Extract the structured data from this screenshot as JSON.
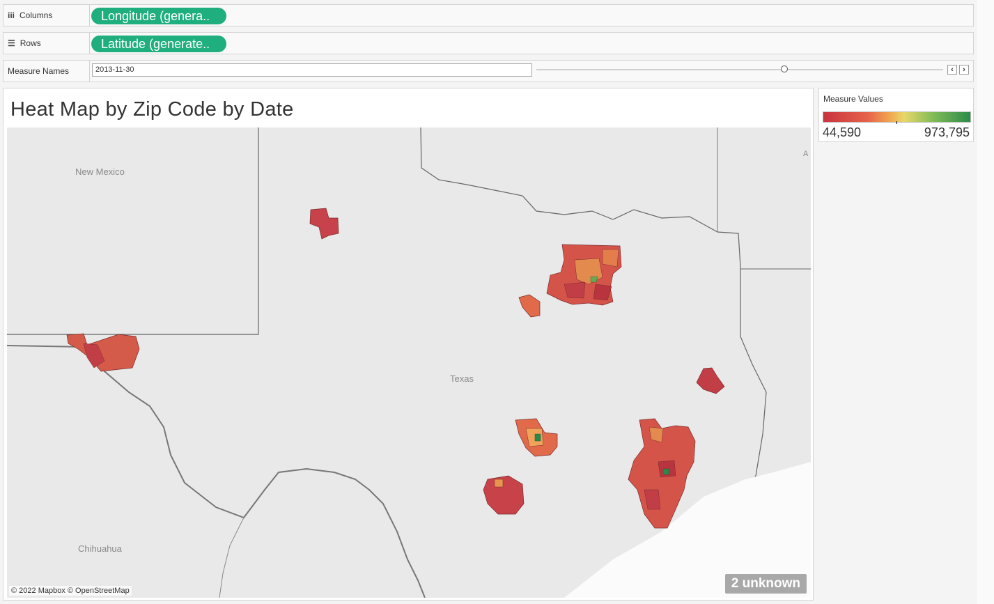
{
  "shelves": {
    "columns": {
      "label": "Columns",
      "icon": "columns-icon",
      "pill": "Longitude (genera.."
    },
    "rows": {
      "label": "Rows",
      "icon": "rows-icon",
      "pill": "Latitude (generate.."
    }
  },
  "filter": {
    "label": "Measure Names",
    "date_value": "2013-11-30",
    "slider_position": 0.6,
    "prev_label": "‹",
    "next_label": "›"
  },
  "viz": {
    "title": "Heat Map by Zip Code by Date",
    "map_labels": {
      "new_mexico": "New Mexico",
      "texas": "Texas",
      "chihuahua": "Chihuahua",
      "edge_a": "A"
    },
    "attribution": "© 2022 Mapbox © OpenStreetMap",
    "unknown_badge": "2 unknown"
  },
  "legend": {
    "title": "Measure Values",
    "min": "44,590",
    "max": "973,795",
    "colors": {
      "low": "#c8333f",
      "mid": "#e8d76a",
      "high": "#2b8a4a"
    }
  },
  "colors": {
    "pill": "#1fae7d"
  }
}
